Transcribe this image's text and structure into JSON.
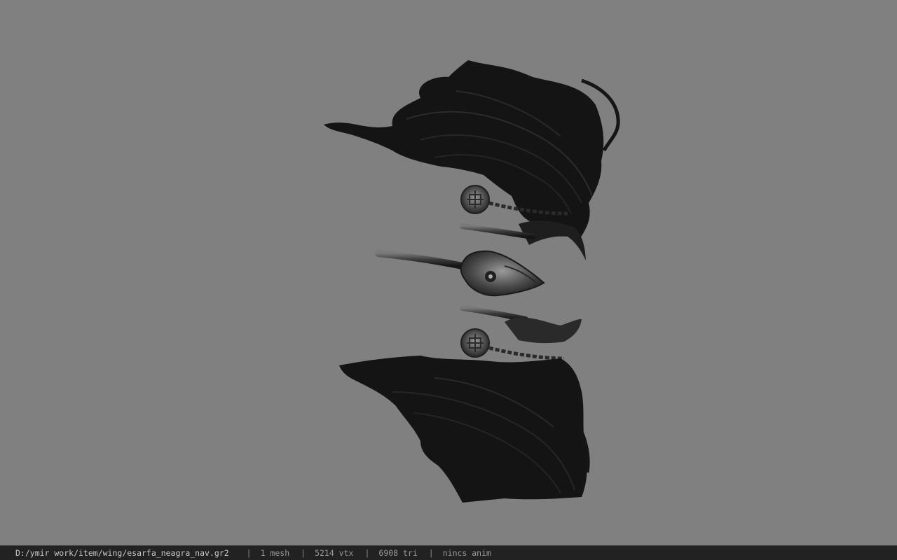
{
  "viewport": {
    "background": "#808080",
    "model": "black-feather-wings-icon"
  },
  "status": {
    "path": "D:/ymir work/item/wing/esarfa_neagra_nav.gr2",
    "separator": "|",
    "meshes": "1 mesh",
    "vertices": "5214 vtx",
    "triangles": "6908 tri",
    "animation": "nincs anim"
  }
}
